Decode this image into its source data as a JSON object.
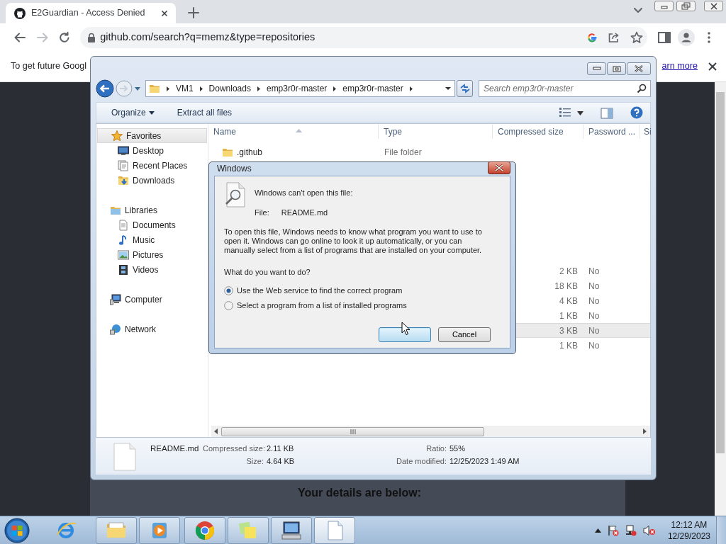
{
  "browser": {
    "tabs": [
      {
        "title": "E2Guardian - Access Denied",
        "selected": true
      }
    ],
    "back": {
      "disabled": false
    },
    "forward": {
      "disabled": true
    },
    "url": "github.com/search?q=memz&type=repositories"
  },
  "infobar": {
    "text": "To get future Googl",
    "link": "arn more"
  },
  "page": {
    "heading": "Your details are below:"
  },
  "explorer": {
    "breadcrumb": [
      "VM1",
      "Downloads",
      "emp3r0r-master",
      "emp3r0r-master"
    ],
    "search": {
      "placeholder": "Search emp3r0r-master"
    },
    "toolbar": [
      {
        "label": "Organize",
        "kind": "menu"
      },
      {
        "label": "Extract all files",
        "kind": "button"
      }
    ],
    "nav": [
      {
        "label": "Favorites",
        "selected": true,
        "children": [
          {
            "label": "Desktop",
            "selected": false
          },
          {
            "label": "Recent Places",
            "selected": false
          },
          {
            "label": "Downloads",
            "selected": false
          }
        ]
      },
      {
        "label": "Libraries",
        "selected": false,
        "children": [
          {
            "label": "Documents",
            "selected": false
          },
          {
            "label": "Music",
            "selected": false
          },
          {
            "label": "Pictures",
            "selected": false
          },
          {
            "label": "Videos",
            "selected": false
          }
        ]
      },
      {
        "label": "Computer",
        "selected": false
      },
      {
        "label": "Network",
        "selected": false
      }
    ],
    "columns": [
      "Name",
      "Type",
      "Compressed size",
      "Password ...",
      "Si"
    ],
    "rows": [
      {
        "name": ".github",
        "type": "File folder",
        "selected": false
      },
      {
        "compressed_size": "2 KB",
        "password": "No",
        "selected": false
      },
      {
        "compressed_size": "18 KB",
        "password": "No",
        "selected": false
      },
      {
        "compressed_size": "4 KB",
        "password": "No",
        "selected": false
      },
      {
        "compressed_size": "1 KB",
        "password": "No",
        "selected": false
      },
      {
        "compressed_size": "3 KB",
        "password": "No",
        "selected": true
      },
      {
        "compressed_size": "1 KB",
        "password": "No",
        "selected": false
      }
    ],
    "details": {
      "name": "README.md",
      "fields": [
        {
          "label": "Compressed size:",
          "value": "2.11 KB"
        },
        {
          "label": "Size:",
          "value": "4.64 KB"
        },
        {
          "label": "Ratio:",
          "value": "55%"
        },
        {
          "label": "Date modified:",
          "value": "12/25/2023 1:49 AM"
        }
      ]
    }
  },
  "dialog": {
    "title": "Windows",
    "heading": "Windows can't open this file:",
    "file_label": "File:",
    "file_name": "README.md",
    "message": "To open this file, Windows needs to know what program you want to use to open it. Windows can go online to look it up automatically, or you can manually select from a list of programs that are installed on your computer.",
    "question": "What do you want to do?",
    "options": [
      {
        "label": "Use the Web service to find the correct program",
        "selected": true
      },
      {
        "label": "Select a program from a list of installed programs",
        "selected": false
      }
    ],
    "buttons": [
      {
        "focused": true
      },
      {
        "label": "Cancel",
        "focused": false
      }
    ]
  },
  "taskbar": {
    "buttons": [
      {
        "running": false,
        "active": false
      },
      {
        "running": true,
        "active": false
      },
      {
        "running": true,
        "active": false
      },
      {
        "running": true,
        "active": false
      },
      {
        "running": true,
        "active": false
      },
      {
        "running": true,
        "active": false
      },
      {
        "running": true,
        "active": true
      }
    ],
    "clock": {
      "time": "12:12 AM",
      "date": "12/29/2023"
    }
  }
}
